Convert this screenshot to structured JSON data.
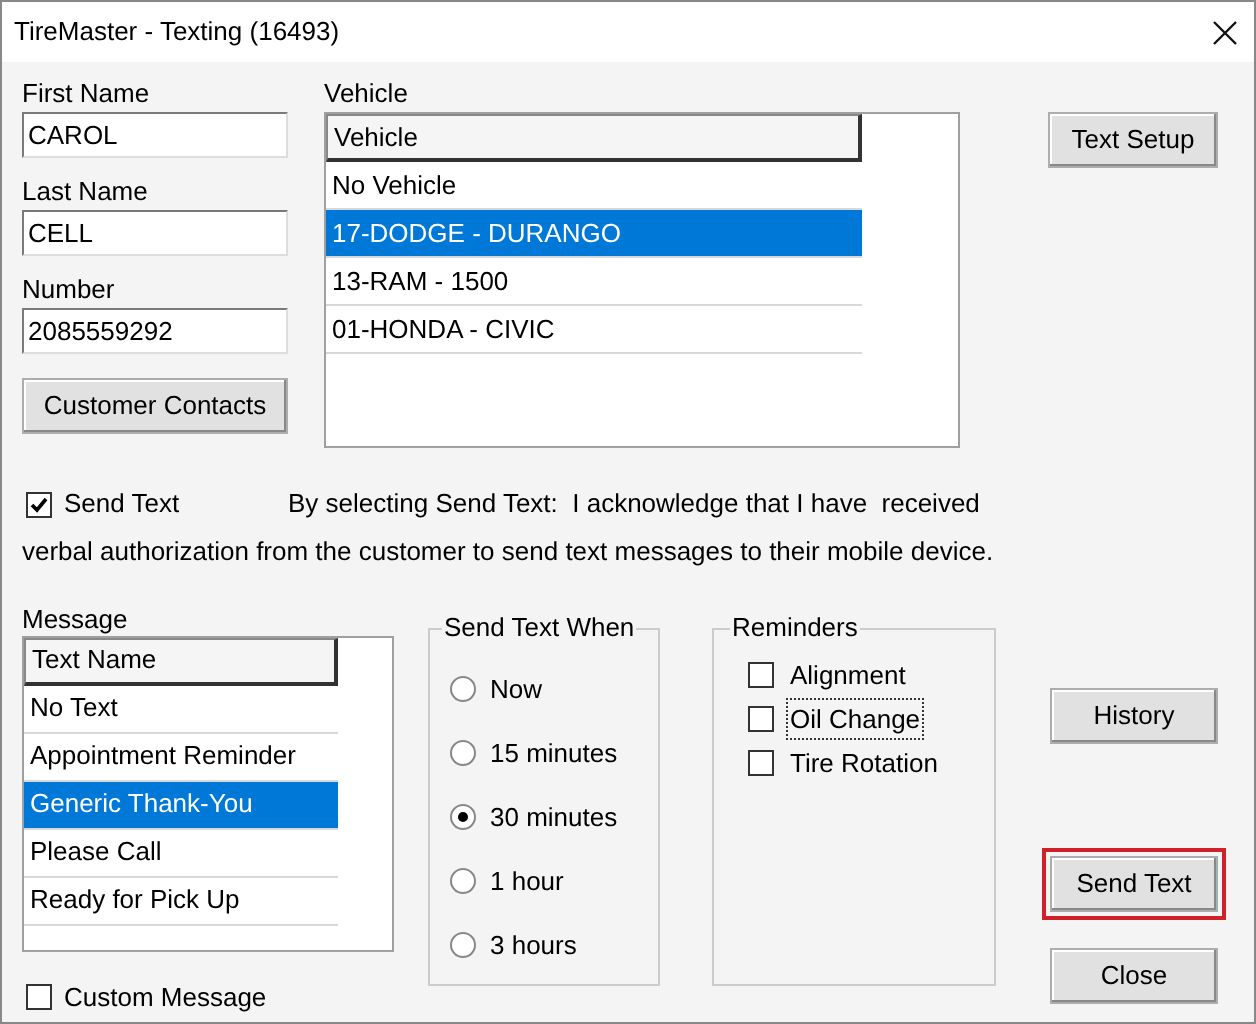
{
  "window": {
    "title": "TireMaster - Texting (16493)"
  },
  "customer_fields": [
    {
      "label": "First Name",
      "value": "CAROL"
    },
    {
      "label": "Last Name",
      "value": "CELL"
    },
    {
      "label": "Number",
      "value": "2085559292"
    }
  ],
  "customer_contacts_button": "Customer Contacts",
  "vehicle": {
    "label": "Vehicle",
    "column": "Vehicle",
    "rows": [
      {
        "text": "No Vehicle",
        "selected": false
      },
      {
        "text": "17-DODGE - DURANGO",
        "selected": true
      },
      {
        "text": "13-RAM - 1500",
        "selected": false
      },
      {
        "text": "01-HONDA - CIVIC",
        "selected": false
      }
    ]
  },
  "text_setup_button": "Text Setup",
  "send_text": {
    "label": "Send Text",
    "checked": true,
    "notice_line_1": "By selecting Send Text:  I acknowledge that I have  received",
    "notice_line_2": "verbal authorization from the customer to send text messages to their mobile device."
  },
  "message": {
    "label": "Message",
    "column": "Text Name",
    "rows": [
      {
        "text": "No Text",
        "selected": false
      },
      {
        "text": "Appointment Reminder",
        "selected": false
      },
      {
        "text": "Generic Thank-You",
        "selected": true
      },
      {
        "text": "Please Call",
        "selected": false
      },
      {
        "text": "Ready for Pick Up",
        "selected": false
      }
    ]
  },
  "custom_message": {
    "label": "Custom Message",
    "checked": false
  },
  "send_text_when": {
    "title": "Send Text When",
    "options": [
      {
        "label": "Now",
        "selected": false
      },
      {
        "label": "15 minutes",
        "selected": false
      },
      {
        "label": "30 minutes",
        "selected": true
      },
      {
        "label": "1 hour",
        "selected": false
      },
      {
        "label": "3 hours",
        "selected": false
      }
    ]
  },
  "reminders": {
    "title": "Reminders",
    "items": [
      {
        "label": "Alignment",
        "checked": false,
        "focused": false
      },
      {
        "label": "Oil Change",
        "checked": false,
        "focused": true
      },
      {
        "label": "Tire Rotation",
        "checked": false,
        "focused": false
      }
    ]
  },
  "buttons": [
    {
      "label": "History",
      "highlighted": false
    },
    {
      "label": "Send Text",
      "highlighted": true
    },
    {
      "label": "Close",
      "highlighted": false
    }
  ]
}
